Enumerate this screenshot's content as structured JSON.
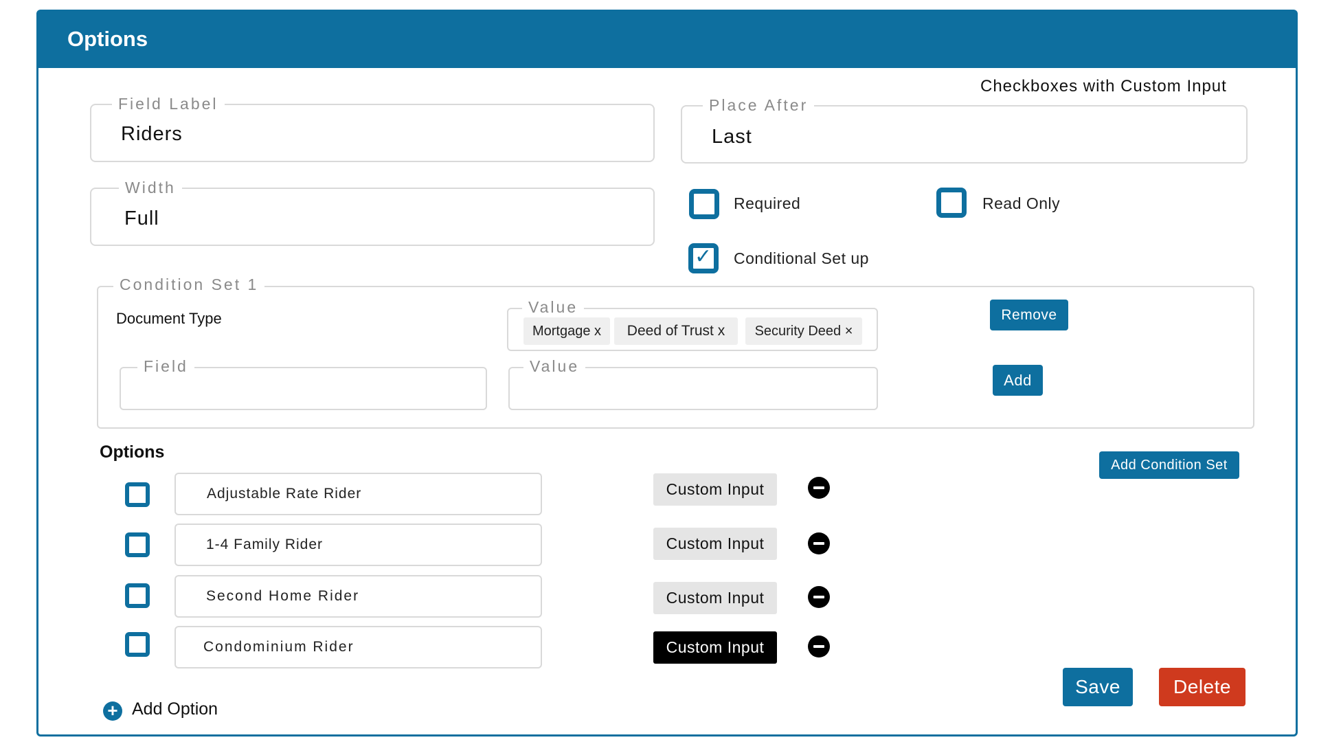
{
  "panel": {
    "title": "Options"
  },
  "field_type": "Checkboxes with Custom Input",
  "field_label": {
    "legend": "Field Label",
    "value": "Riders"
  },
  "place_after": {
    "legend": "Place After",
    "value": "Last"
  },
  "width": {
    "legend": "Width",
    "value": "Full"
  },
  "checkboxes": {
    "required": {
      "label": "Required",
      "checked": false
    },
    "read_only": {
      "label": "Read Only",
      "checked": false
    },
    "conditional": {
      "label": "Conditional Set up",
      "checked": true,
      "check_glyph": "✓"
    }
  },
  "condition_set": {
    "legend": "Condition Set 1",
    "field_name": "Document Type",
    "value_legend": "Value",
    "chips": [
      "Mortgage x",
      "Deed of Trust x",
      "Security Deed ×"
    ],
    "remove_label": "Remove",
    "new_field_legend": "Field",
    "new_value_legend": "Value",
    "add_label": "Add"
  },
  "options": {
    "heading": "Options",
    "add_condition_set_label": "Add Condition Set",
    "items": [
      {
        "label": "Adjustable Rate Rider",
        "custom_input": "Custom Input",
        "custom_active": false
      },
      {
        "label": "1-4 Family Rider",
        "custom_input": "Custom Input",
        "custom_active": false
      },
      {
        "label": "Second Home Rider",
        "custom_input": "Custom Input",
        "custom_active": false
      },
      {
        "label": "Condominium Rider",
        "custom_input": "Custom Input",
        "custom_active": true
      }
    ],
    "add_option_label": "Add Option",
    "add_option_icon": "+"
  },
  "footer": {
    "save_label": "Save",
    "delete_label": "Delete"
  },
  "colors": {
    "accent": "#0e6f9f",
    "danger": "#cf3a1e",
    "active_custom": "#000000",
    "inactive_custom": "#e5e5e5"
  }
}
